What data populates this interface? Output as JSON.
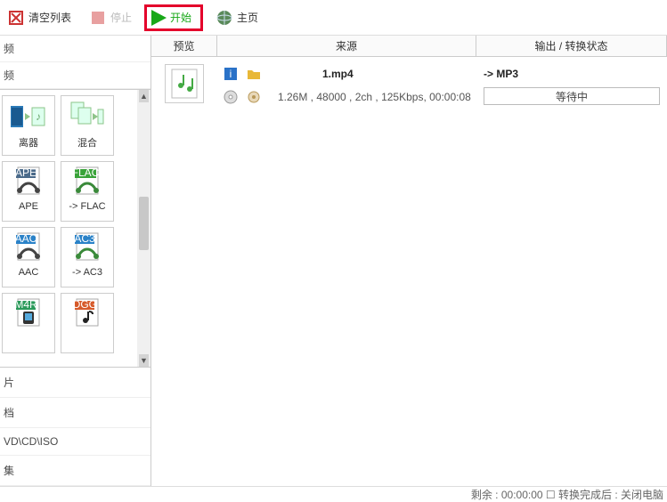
{
  "toolbar": {
    "clear": "清空列表",
    "stop": "停止",
    "start": "开始",
    "home": "主页"
  },
  "sidebar": {
    "top_items": [
      "频",
      "频"
    ],
    "tiles": [
      {
        "name": "离器",
        "kind": "separator"
      },
      {
        "name": "混合",
        "kind": "mixer"
      },
      {
        "name": "APE",
        "kind": "ape"
      },
      {
        "name": "-> FLAC",
        "kind": "flac"
      },
      {
        "name": "AAC",
        "kind": "aac"
      },
      {
        "name": "-> AC3",
        "kind": "ac3"
      },
      {
        "name": "",
        "kind": "m4r"
      },
      {
        "name": "",
        "kind": "ogg"
      }
    ],
    "categories": [
      "片",
      "档",
      "VD\\CD\\ISO",
      "集"
    ]
  },
  "columns": {
    "preview": "预览",
    "source": "来源",
    "status": "输出 / 转换状态"
  },
  "item": {
    "filename": "1.mp4",
    "meta": "1.26M , 48000 , 2ch , 125Kbps, 00:00:08",
    "target": "-> MP3",
    "progress": "等待中"
  },
  "footer": "剩余 : 00:00:00  ☐ 转换完成后 : 关闭电脑"
}
